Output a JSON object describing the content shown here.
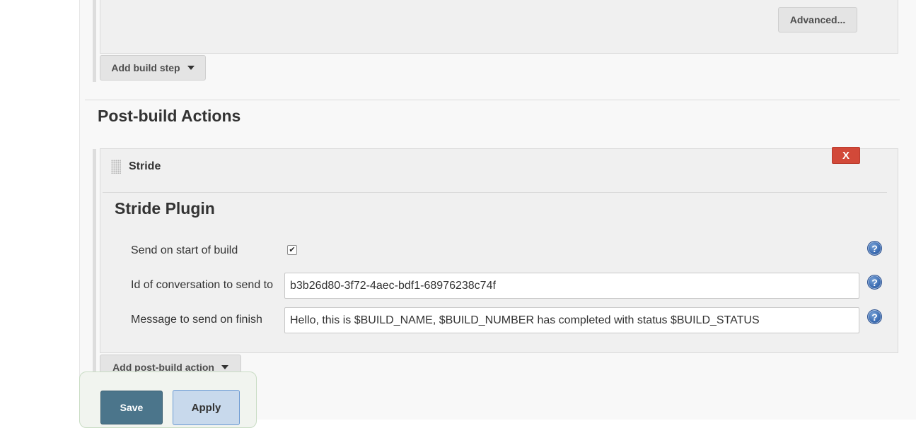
{
  "build": {
    "advanced_label": "Advanced...",
    "add_build_step_label": "Add build step"
  },
  "post_build": {
    "section_title": "Post-build Actions",
    "stride": {
      "header_label": "Stride",
      "delete_label": "X",
      "plugin_title": "Stride Plugin",
      "fields": {
        "send_on_start": {
          "label": "Send on start of build",
          "checked": true
        },
        "conversation_id": {
          "label": "Id of conversation to send to",
          "value": "b3b26d80-3f72-4aec-bdf1-68976238c74f"
        },
        "finish_message": {
          "label": "Message to send on finish",
          "value": "Hello, this is $BUILD_NAME, $BUILD_NUMBER has completed with status $BUILD_STATUS"
        }
      },
      "help_label": "?"
    },
    "add_post_build_label": "Add post-build action"
  },
  "footer": {
    "save_label": "Save",
    "apply_label": "Apply"
  },
  "colors": {
    "delete_button": "#d24939",
    "save_button": "#4b758b",
    "apply_button": "#c8d9ec",
    "help_icon": "#3c6db3"
  },
  "icons": {
    "help": "help-icon",
    "drag": "drag-handle-icon",
    "dropdown": "caret-down-icon",
    "checkbox": "checkmark-icon"
  }
}
